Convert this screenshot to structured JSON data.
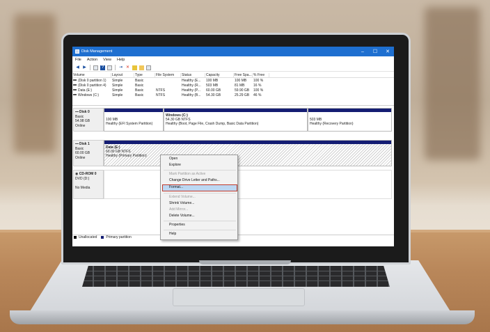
{
  "window": {
    "title": "Disk Management",
    "controls": [
      "–",
      "☐",
      "✕"
    ]
  },
  "menu": [
    "File",
    "Action",
    "View",
    "Help"
  ],
  "toolbar_icons": [
    "back-icon",
    "forward-icon",
    "list-icon",
    "help-icon",
    "properties-icon",
    "connect-icon",
    "delete-icon",
    "check-icon",
    "folder-icon",
    "view-icon"
  ],
  "volume_list": {
    "headers": [
      "Volume",
      "Layout",
      "Type",
      "File System",
      "Status",
      "Capacity",
      "Free Spa...",
      "% Free"
    ],
    "rows": [
      [
        "(Disk 0 partition 1)",
        "Simple",
        "Basic",
        "",
        "Healthy (E...",
        "100 MB",
        "100 MB",
        "100 %"
      ],
      [
        "(Disk 0 partition 4)",
        "Simple",
        "Basic",
        "",
        "Healthy (R...",
        "503 MB",
        "81 MB",
        "16 %"
      ],
      [
        "Data (E:)",
        "Simple",
        "Basic",
        "NTFS",
        "Healthy (P...",
        "60.00 GB",
        "59.90 GB",
        "100 %"
      ],
      [
        "Windows (C:)",
        "Simple",
        "Basic",
        "NTFS",
        "Healthy (B...",
        "54.30 GB",
        "25.29 GB",
        "46 %"
      ]
    ]
  },
  "disks": [
    {
      "name": "Disk 0",
      "type": "Basic",
      "size": "54.98 GB",
      "status": "Online",
      "partitions": [
        {
          "title": "",
          "size": "100 MB",
          "status": "Healthy (EFI System Partition)"
        },
        {
          "title": "Windows (C:)",
          "size": "54.30 GB NTFS",
          "status": "Healthy (Boot, Page File, Crash Dump, Basic Data Partition)"
        },
        {
          "title": "",
          "size": "503 MB",
          "status": "Healthy (Recovery Partition)"
        }
      ]
    },
    {
      "name": "Disk 1",
      "type": "Basic",
      "size": "60.00 GB",
      "status": "Online",
      "partitions": [
        {
          "title": "Data (E:)",
          "size": "60.00 GB NTFS",
          "status": "Healthy (Primary Partition)"
        }
      ]
    },
    {
      "name": "CD-ROM 0",
      "type": "DVD (D:)",
      "size": "",
      "status": "No Media"
    }
  ],
  "legend": {
    "unallocated": "Unallocated",
    "primary": "Primary partition",
    "unallocated_color": "#000000",
    "primary_color": "#141d73"
  },
  "context_menu": {
    "items": [
      {
        "label": "Open",
        "enabled": true
      },
      {
        "label": "Explore",
        "enabled": true
      },
      {
        "label": "Mark Partition as Active",
        "enabled": false
      },
      {
        "label": "Change Drive Letter and Paths...",
        "enabled": true
      },
      {
        "label": "Format...",
        "enabled": true,
        "highlighted": true
      },
      {
        "label": "Extend Volume...",
        "enabled": false
      },
      {
        "label": "Shrink Volume...",
        "enabled": true
      },
      {
        "label": "Add Mirror...",
        "enabled": false
      },
      {
        "label": "Delete Volume...",
        "enabled": true
      },
      {
        "label": "Properties",
        "enabled": true
      },
      {
        "label": "Help",
        "enabled": true
      }
    ]
  },
  "colors": {
    "titlebar": "#1e6fd0",
    "partition_bar": "#141d73",
    "highlight": "#bcd7f2",
    "highlight_border": "#c0392b"
  }
}
